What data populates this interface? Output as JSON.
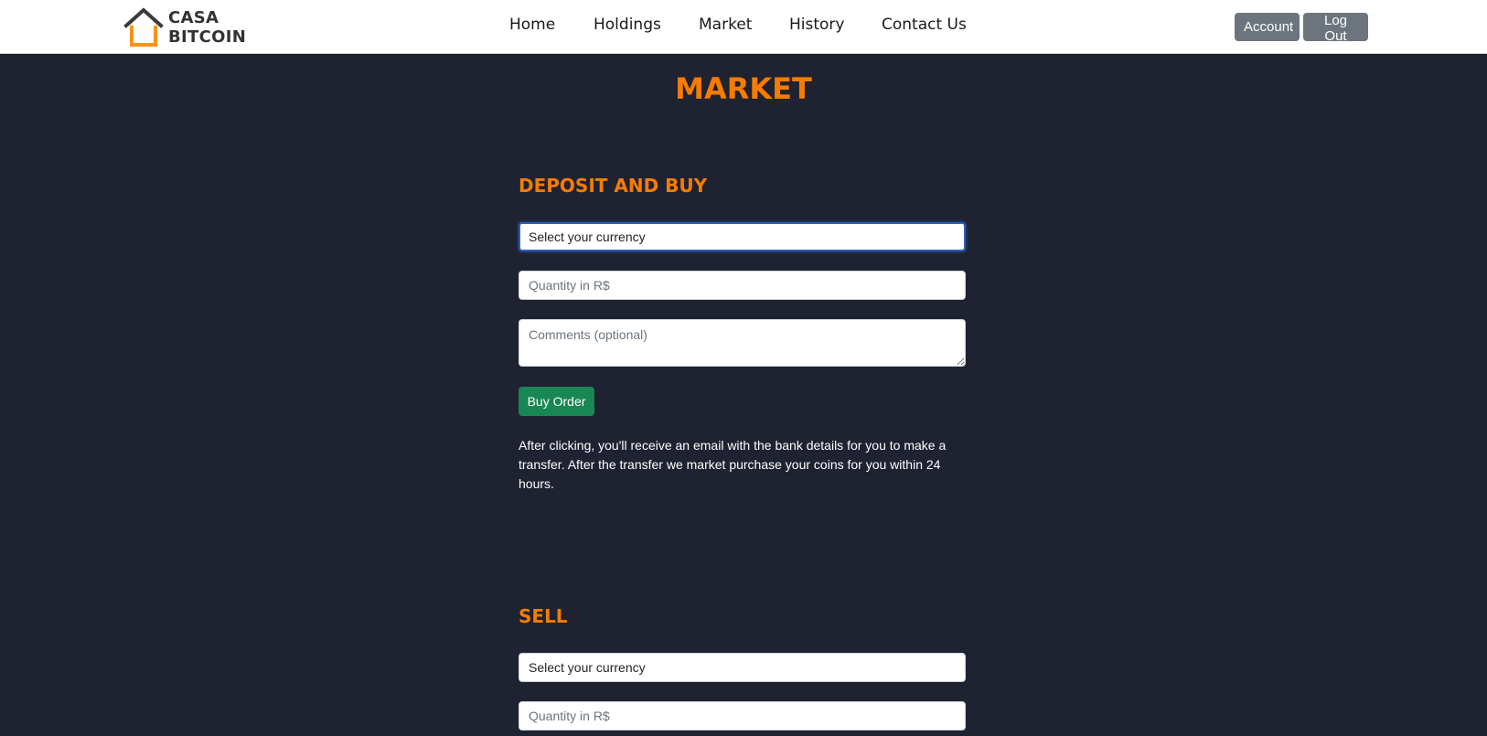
{
  "brand": {
    "line1": "CASA",
    "line2": "BITCOIN",
    "accent_color": "#f7931a",
    "icon": "house-logo-icon"
  },
  "nav": {
    "links": [
      "Home",
      "Holdings",
      "Market",
      "History",
      "Contact Us"
    ],
    "account_label": "Account",
    "logout_label": "Log Out"
  },
  "page": {
    "title": "MARKET",
    "title_color": "#f57c00",
    "background": "#1e2231"
  },
  "buy": {
    "heading": "DEPOSIT AND BUY",
    "currency_select": "Select your currency",
    "quantity_placeholder": "Quantity in R$",
    "comments_placeholder": "Comments (optional)",
    "button_label": "Buy Order",
    "button_color": "#198754",
    "info": "After clicking, you'll receive an email with the bank details for you to make a transfer. After the transfer we market purchase your coins for you within 24 hours."
  },
  "sell": {
    "heading": "SELL",
    "currency_select": "Select your currency",
    "quantity_placeholder": "Quantity in R$"
  }
}
